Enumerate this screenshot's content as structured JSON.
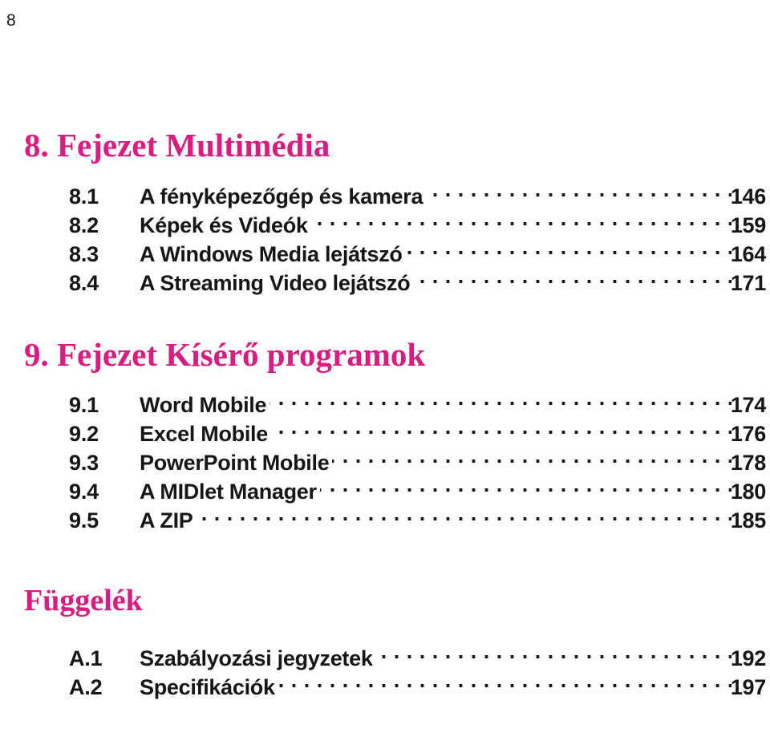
{
  "page": {
    "folio": "8",
    "accent_color": "#DD1A80",
    "text_color": "#161616",
    "background_color": "#FFFFFF"
  },
  "sections": [
    {
      "heading": "8. Fejezet Multimédia",
      "entries": [
        {
          "number": "8.1",
          "title": "A fényképezőgép és kamera",
          "page": "146"
        },
        {
          "number": "8.2",
          "title": "Képek és Videók",
          "page": "159"
        },
        {
          "number": "8.3",
          "title": "A Windows Media lejátszó",
          "page": "164"
        },
        {
          "number": "8.4",
          "title": "A Streaming Video lejátszó",
          "page": "171"
        }
      ]
    },
    {
      "heading": "9. Fejezet Kísérő programok",
      "entries": [
        {
          "number": "9.1",
          "title": "Word Mobile",
          "page": "174"
        },
        {
          "number": "9.2",
          "title": "Excel Mobile",
          "page": "176"
        },
        {
          "number": "9.3",
          "title": "PowerPoint Mobile",
          "page": "178"
        },
        {
          "number": "9.4",
          "title": "A MIDlet Manager",
          "page": "180"
        },
        {
          "number": "9.5",
          "title": "A ZIP",
          "page": "185"
        }
      ]
    },
    {
      "heading": "Függelék",
      "entries": [
        {
          "number": "A.1",
          "title": "Szabályozási jegyzetek",
          "page": "192"
        },
        {
          "number": "A.2",
          "title": "Specifikációk",
          "page": "197"
        }
      ]
    }
  ]
}
